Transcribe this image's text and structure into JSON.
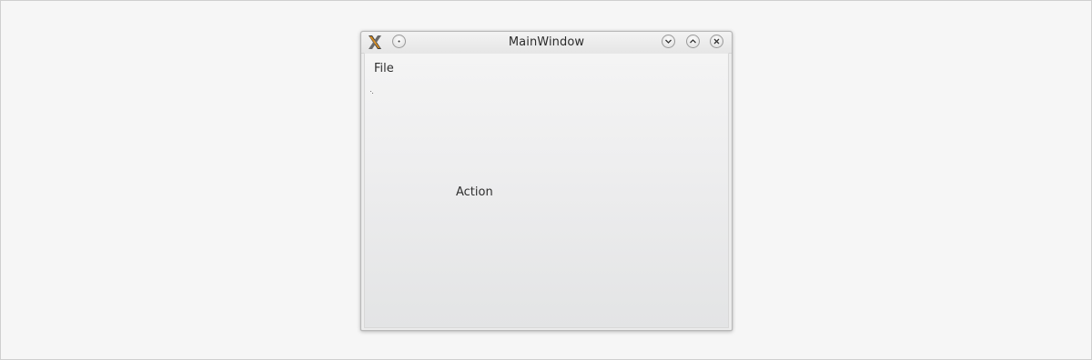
{
  "window": {
    "title": "MainWindow",
    "app_icon": "x-tools-icon",
    "title_buttons": [
      "menu-dot-icon",
      "minimize-icon",
      "maximize-icon",
      "close-icon"
    ]
  },
  "menubar": {
    "items": [
      {
        "label": "File"
      }
    ]
  },
  "content": {
    "action_label": "Action"
  },
  "colors": {
    "desktop_background": "#f6f6f6",
    "window_border": "#b8b8b8",
    "text": "#2e2e2e"
  }
}
